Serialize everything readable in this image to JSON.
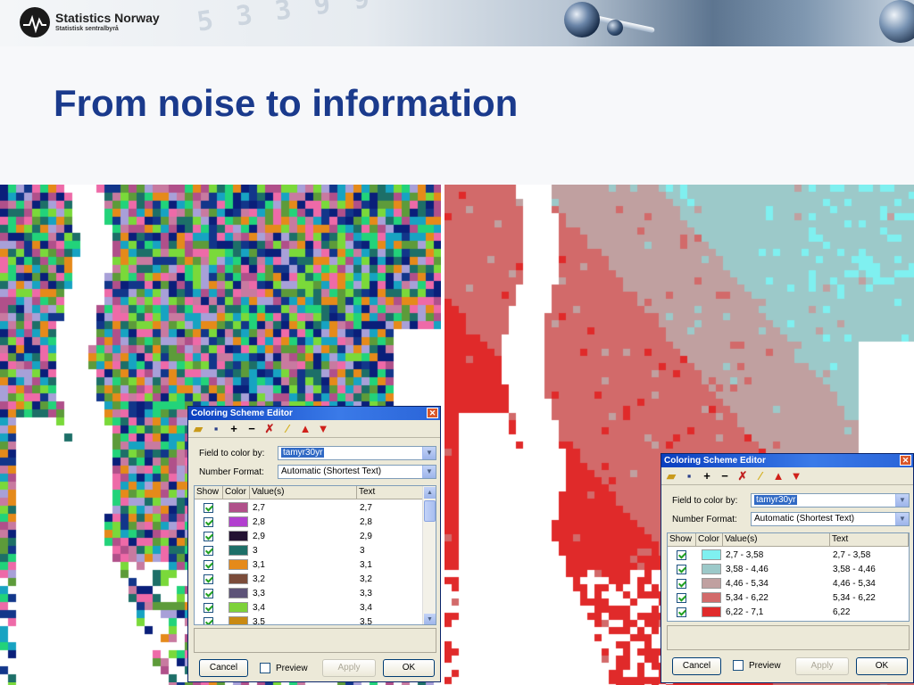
{
  "header": {
    "org_name": "Statistics Norway",
    "org_subtitle": "Statistisk sentralbyrå",
    "logo_icon": "ssb-logo-icon"
  },
  "page": {
    "title": "From noise to information"
  },
  "dialog_left": {
    "title": "Coloring Scheme Editor",
    "field_label": "Field to color by:",
    "field_value": "tamyr30yr",
    "format_label": "Number Format:",
    "format_value": "Automatic (Shortest Text)",
    "columns": [
      "Show",
      "Color",
      "Value(s)",
      "Text"
    ],
    "rows": [
      {
        "value": "2,7",
        "text": "2,7",
        "color": "#b0508a"
      },
      {
        "value": "2,8",
        "text": "2,8",
        "color": "#b23fcf"
      },
      {
        "value": "2,9",
        "text": "2,9",
        "color": "#231132"
      },
      {
        "value": "3",
        "text": "3",
        "color": "#1d6f68"
      },
      {
        "value": "3,1",
        "text": "3,1",
        "color": "#e58a1a"
      },
      {
        "value": "3,2",
        "text": "3,2",
        "color": "#7b4c3a"
      },
      {
        "value": "3,3",
        "text": "3,3",
        "color": "#5d5378"
      },
      {
        "value": "3,4",
        "text": "3,4",
        "color": "#7ed23a"
      },
      {
        "value": "3,5",
        "text": "3,5",
        "color": "#c98a12"
      }
    ],
    "cancel_label": "Cancel",
    "preview_label": "Preview",
    "apply_label": "Apply",
    "ok_label": "OK"
  },
  "dialog_right": {
    "title": "Coloring Scheme Editor",
    "field_label": "Field to color by:",
    "field_value": "tamyr30yr",
    "format_label": "Number Format:",
    "format_value": "Automatic (Shortest Text)",
    "columns": [
      "Show",
      "Color",
      "Value(s)",
      "Text"
    ],
    "rows": [
      {
        "value": "2,7 - 3,58",
        "text": "2,7 - 3,58",
        "color": "#7ff0f0"
      },
      {
        "value": "3,58 - 4,46",
        "text": "3,58 - 4,46",
        "color": "#9cc9c9"
      },
      {
        "value": "4,46 - 5,34",
        "text": "4,46 - 5,34",
        "color": "#c0a0a0"
      },
      {
        "value": "5,34 - 6,22",
        "text": "5,34 - 6,22",
        "color": "#d26a6a"
      },
      {
        "value": "6,22 - 7,1",
        "text": "6,22",
        "color": "#e02a2a"
      }
    ],
    "cancel_label": "Cancel",
    "preview_label": "Preview",
    "apply_label": "Apply",
    "ok_label": "OK"
  },
  "colors": {
    "title": "#1a3a8c",
    "noise_palette": [
      "#ee6aa8",
      "#7ad93a",
      "#0a1f7a",
      "#17a3c2",
      "#e58a1a",
      "#b0508a",
      "#5d9b3a",
      "#a8a0d8",
      "#1d6f68",
      "#c87aa0",
      "#22d37a",
      "#12368a"
    ],
    "info_palette": [
      "#7ff0f0",
      "#9cc9c9",
      "#c0a0a0",
      "#d26a6a",
      "#e02a2a"
    ]
  }
}
